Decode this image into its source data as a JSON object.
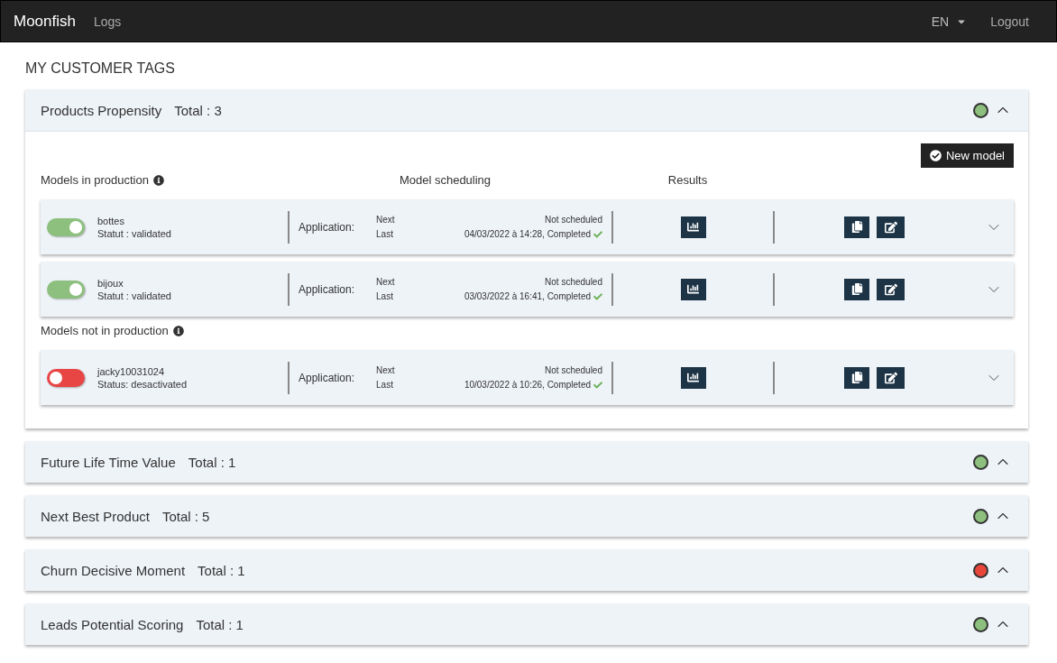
{
  "navbar": {
    "brand": "Moonfish",
    "links": [
      "Logs"
    ],
    "language": "EN",
    "logout": "Logout"
  },
  "page_title": "MY CUSTOMER TAGS",
  "tags": [
    {
      "name": "Products Propensity",
      "total": "Total : 3",
      "color": "#8dc07e",
      "expanded": true,
      "new_model": "New model",
      "column_headers": [
        "Model scheduling",
        "Results"
      ],
      "groups": [
        {
          "title": "Models in production",
          "models": [
            {
              "name": "bottes",
              "status": "Statut : validated",
              "on": true,
              "application": "Application:",
              "next_label": "Next",
              "next_value": "Not scheduled",
              "last_label": "Last",
              "last_value": "04/03/2022 à 14:28, Completed",
              "completed": true
            },
            {
              "name": "bijoux",
              "status": "Statut : validated",
              "on": true,
              "application": "Application:",
              "next_label": "Next",
              "next_value": "Not scheduled",
              "last_label": "Last",
              "last_value": "03/03/2022 à 16:41, Completed",
              "completed": true
            }
          ]
        },
        {
          "title": "Models not in production",
          "models": [
            {
              "name": "jacky10031024",
              "status": "Status: desactivated",
              "on": false,
              "application": "Application:",
              "next_label": "Next",
              "next_value": "Not scheduled",
              "last_label": "Last",
              "last_value": "10/03/2022 à 10:26, Completed",
              "completed": true
            }
          ]
        }
      ]
    },
    {
      "name": "Future Life Time Value",
      "total": "Total : 1",
      "color": "#8dc07e",
      "expanded": false
    },
    {
      "name": "Next Best Product",
      "total": "Total : 5",
      "color": "#8dc07e",
      "expanded": false
    },
    {
      "name": "Churn Decisive Moment",
      "total": "Total : 1",
      "color": "#e8463a",
      "expanded": false
    },
    {
      "name": "Leads Potential Scoring",
      "total": "Total : 1",
      "color": "#8dc07e",
      "expanded": false
    }
  ]
}
